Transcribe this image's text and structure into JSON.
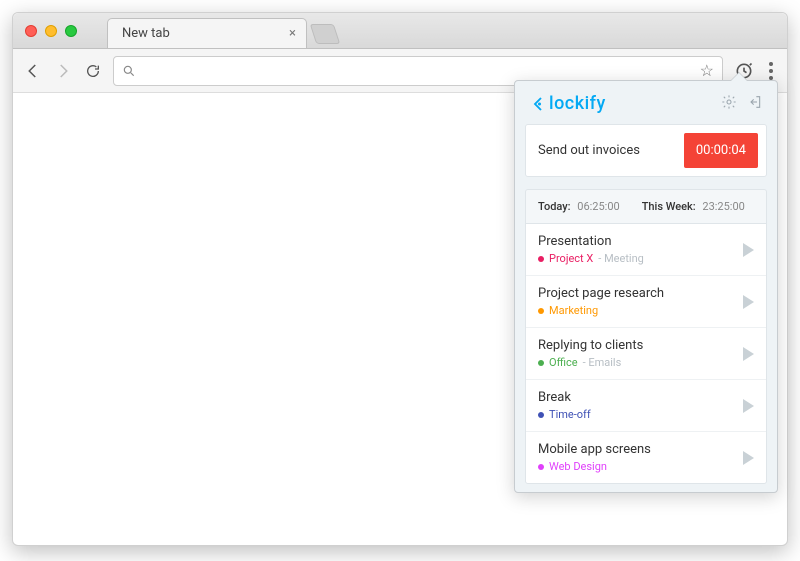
{
  "browser": {
    "tab_title": "New tab",
    "url_value": "",
    "url_placeholder": ""
  },
  "popup": {
    "brand": "lockify",
    "current_entry": {
      "description": "Send out invoices",
      "elapsed": "00:00:04"
    },
    "stats": {
      "today_label": "Today:",
      "today_value": "06:25:00",
      "week_label": "This Week:",
      "week_value": "23:25:00"
    },
    "entries": [
      {
        "title": "Presentation",
        "project": "Project X",
        "color": "#e91e63",
        "tag": "Meeting"
      },
      {
        "title": "Project page research",
        "project": "Marketing",
        "color": "#ff9800",
        "tag": ""
      },
      {
        "title": "Replying to clients",
        "project": "Office",
        "color": "#4caf50",
        "tag": "Emails"
      },
      {
        "title": "Break",
        "project": "Time-off",
        "color": "#3f51b5",
        "tag": ""
      },
      {
        "title": "Mobile app screens",
        "project": "Web Design",
        "color": "#e040fb",
        "tag": ""
      }
    ]
  }
}
